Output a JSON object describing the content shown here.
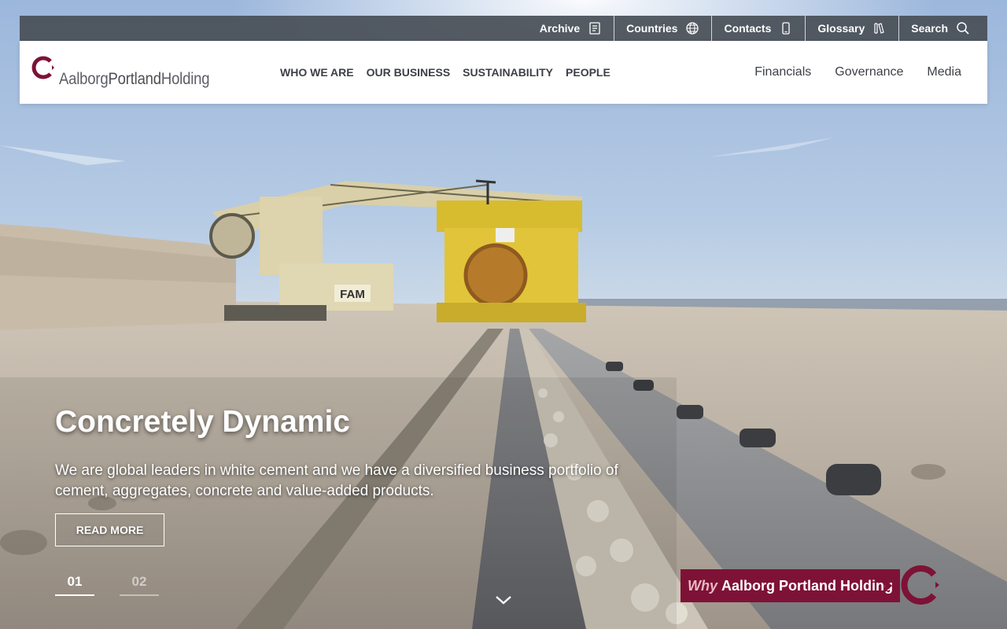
{
  "utility": {
    "items": [
      {
        "label": "Archive",
        "icon": "archive-icon"
      },
      {
        "label": "Countries",
        "icon": "globe-icon"
      },
      {
        "label": "Contacts",
        "icon": "phone-icon"
      },
      {
        "label": "Glossary",
        "icon": "books-icon"
      },
      {
        "label": "Search",
        "icon": "search-icon"
      }
    ]
  },
  "header": {
    "logo": {
      "part1": "Aalborg",
      "part2": "Portland",
      "part3": "Holding",
      "mark": "crescent-c-logo"
    },
    "primary_nav": [
      "WHO WE ARE",
      "OUR BUSINESS",
      "SUSTAINABILITY",
      "PEOPLE"
    ],
    "secondary_nav": [
      "Financials",
      "Governance",
      "Media"
    ]
  },
  "hero": {
    "title": "Concretely Dynamic",
    "description": "We are global leaders in white cement and we have a diversified business portfolio of cement, aggregates, concrete and value-added products.",
    "cta_label": "READ MORE",
    "slides": [
      "01",
      "02"
    ],
    "active_slide": 0,
    "machine_sign": "FAM"
  },
  "why_banner": {
    "prefix": "Why",
    "text": "Aalborg Portland Holding"
  },
  "colors": {
    "brand": "#7e1236",
    "utility_bar": "#484e56",
    "nav_text": "#3d4046"
  }
}
